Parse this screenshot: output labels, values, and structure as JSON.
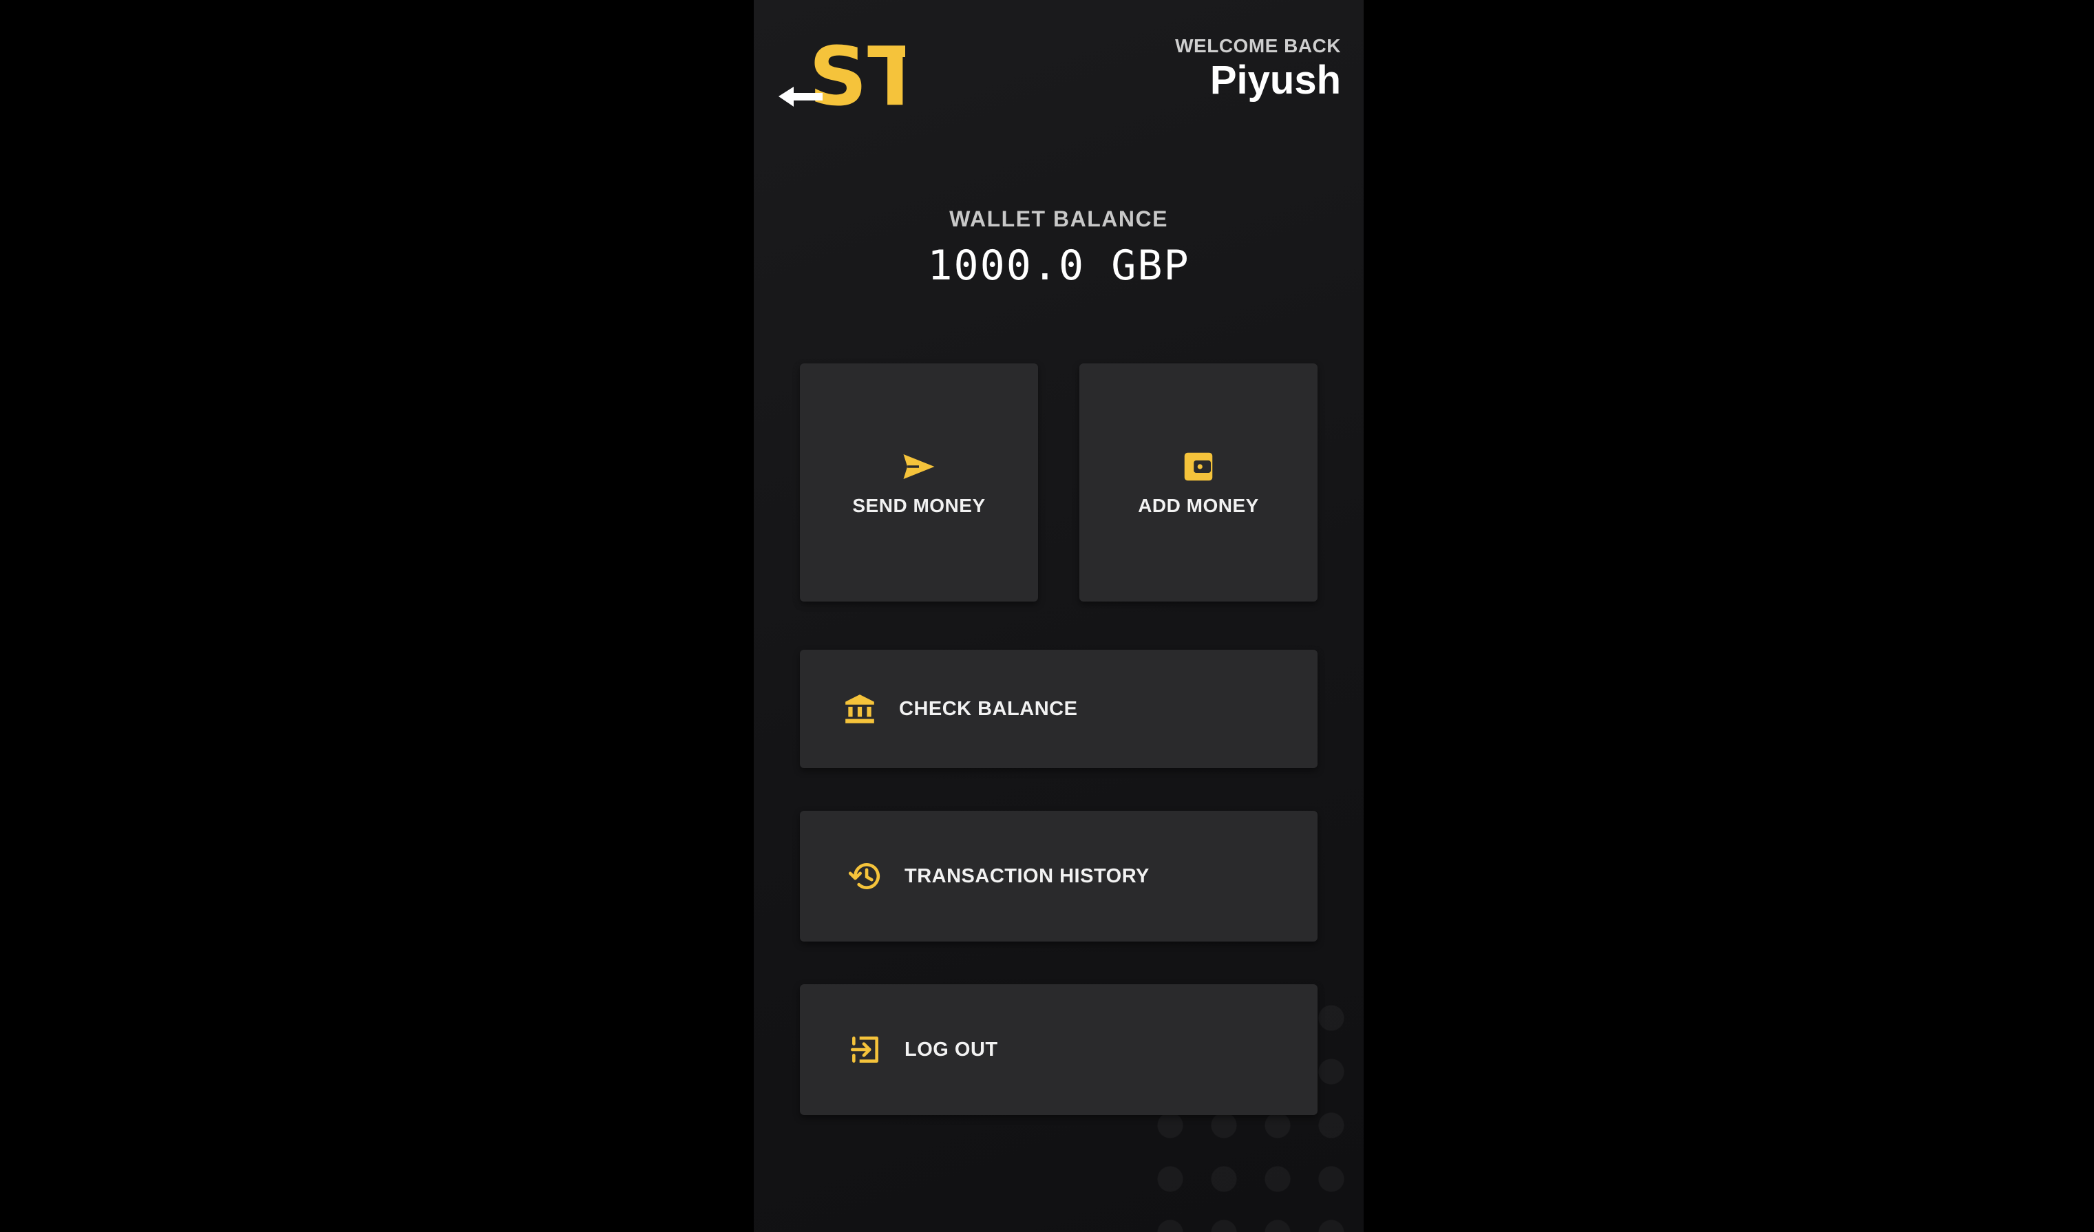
{
  "header": {
    "welcome_label": "WELCOME BACK",
    "user_name": "Piyush",
    "logo_text": "ST",
    "logo_icon": "back-arrow-logo"
  },
  "wallet": {
    "label": "WALLET BALANCE",
    "amount": "1000.0 GBP"
  },
  "actions": {
    "send_money": {
      "label": "SEND MONEY",
      "icon": "send-icon"
    },
    "add_money": {
      "label": "ADD MONEY",
      "icon": "wallet-icon"
    },
    "check_balance": {
      "label": "CHECK BALANCE",
      "icon": "bank-icon"
    },
    "transaction_history": {
      "label": "TRANSACTION HISTORY",
      "icon": "history-icon"
    },
    "log_out": {
      "label": "LOG OUT",
      "icon": "logout-icon"
    }
  },
  "colors": {
    "accent": "#f5c33b",
    "background": "#000000",
    "panel": "#141416",
    "card": "#2a2a2c",
    "text": "#ffffff"
  }
}
